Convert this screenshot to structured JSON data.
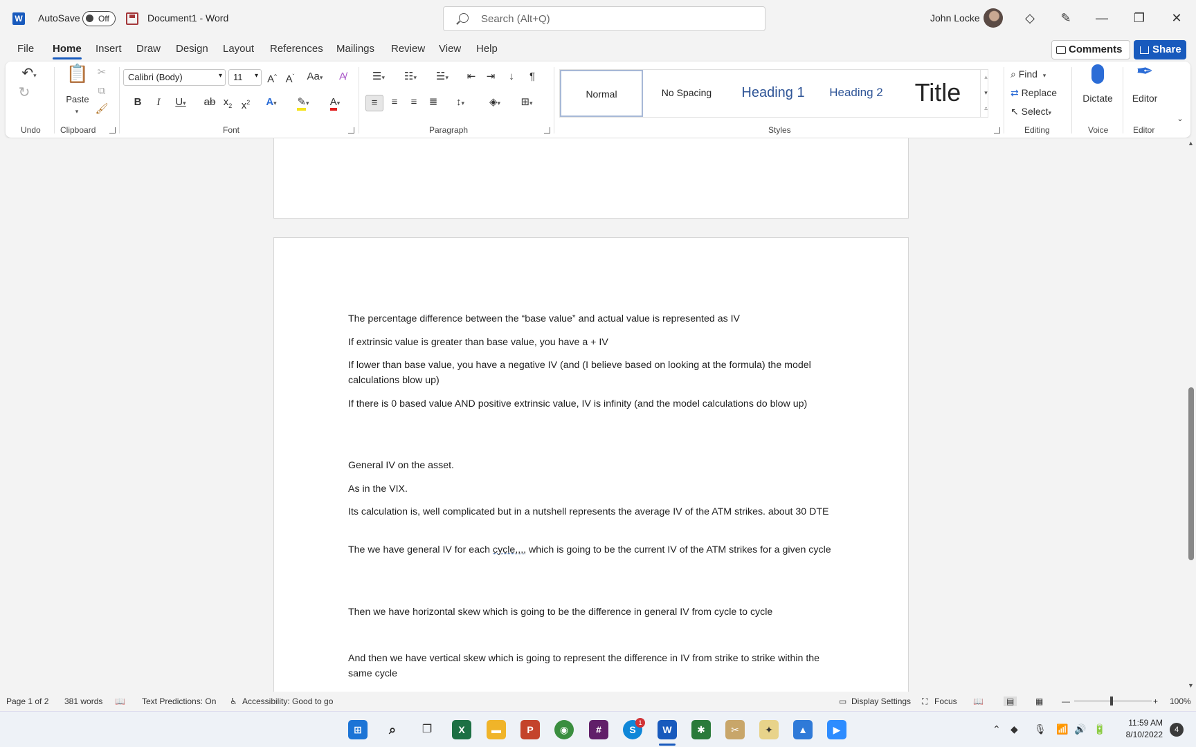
{
  "titlebar": {
    "autosave_label": "AutoSave",
    "autosave_state": "Off",
    "doc_title": "Document1  -  Word",
    "search_placeholder": "Search (Alt+Q)",
    "user_name": "John Locke"
  },
  "menu": {
    "tabs": [
      "File",
      "Home",
      "Insert",
      "Draw",
      "Design",
      "Layout",
      "References",
      "Mailings",
      "Review",
      "View",
      "Help"
    ],
    "active": "Home",
    "comments_label": "Comments",
    "share_label": "Share"
  },
  "ribbon": {
    "groups": [
      "Undo",
      "Clipboard",
      "Font",
      "Paragraph",
      "Styles",
      "Editing",
      "Voice",
      "Editor"
    ],
    "paste_label": "Paste",
    "font_name": "Calibri (Body)",
    "font_size": "11",
    "styles": [
      "Normal",
      "No Spacing",
      "Heading 1",
      "Heading 2",
      "Title"
    ],
    "editing": {
      "find": "Find",
      "replace": "Replace",
      "select": "Select"
    },
    "dictate_label": "Dictate",
    "editor_label": "Editor",
    "accent_color": "#185abd",
    "heading_color": "#2f5597"
  },
  "document": {
    "paragraphs": [
      "The percentage difference between the “base value” and actual value is represented as IV",
      "If extrinsic value is greater than base value, you have a + IV",
      "If lower than base value, you have a negative IV (and (I believe based on looking at the formula) the model calculations blow up)",
      "If there is 0 based value AND positive extrinsic value, IV is infinity (and the model calculations do blow up)",
      "General IV on the asset.",
      "As in the VIX.",
      "Its calculation is, well complicated but in a nutshell represents the average IV of the ATM strikes.  about 30 DTE",
      "Then we have horizontal skew which is going to be the difference in general IV from cycle to cycle",
      "And then we have vertical skew which is going to represent the difference in IV from strike to strike within the same cycle"
    ],
    "para8_before": "The we have general IV for each ",
    "para8_squiggle": "cycle,,,,",
    "para8_after": " which is going to be the current IV of the ATM strikes for a given cycle"
  },
  "status": {
    "page": "Page 1 of 2",
    "words": "381 words",
    "text_predictions": "Text Predictions: On",
    "accessibility": "Accessibility: Good to go",
    "display_settings": "Display Settings",
    "focus": "Focus",
    "zoom": "100%"
  },
  "taskbar": {
    "time": "11:59 AM",
    "date": "8/10/2022",
    "notifications": "4",
    "skype_badge": "1"
  }
}
